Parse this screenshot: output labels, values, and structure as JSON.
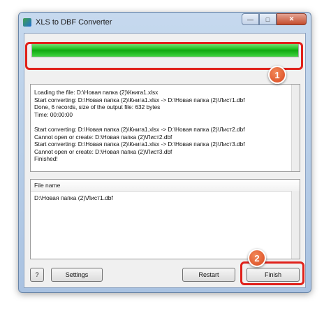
{
  "window": {
    "title": "XLS to DBF Converter",
    "controls": {
      "minimize": "—",
      "maximize": "□",
      "close": "✕"
    }
  },
  "progress": {
    "fraction": 1.0,
    "color": "#22c322"
  },
  "log": {
    "lines": [
      "Loading the file: D:\\Новая папка (2)\\Книга1.xlsx",
      "Start converting: D:\\Новая папка (2)\\Книга1.xlsx -> D:\\Новая папка (2)\\Лист1.dbf",
      "Done, 6 records, size of the output file: 632 bytes",
      "Time: 00:00:00",
      "",
      "Start converting: D:\\Новая папка (2)\\Книга1.xlsx -> D:\\Новая папка (2)\\Лист2.dbf",
      "Cannot open or create: D:\\Новая папка (2)\\Лист2.dbf",
      "Start converting: D:\\Новая папка (2)\\Книга1.xlsx -> D:\\Новая папка (2)\\Лист3.dbf",
      "Cannot open or create: D:\\Новая папка (2)\\Лист3.dbf",
      "Finished!"
    ]
  },
  "files": {
    "header": "File name",
    "rows": [
      "D:\\Новая папка (2)\\Лист1.dbf"
    ]
  },
  "buttons": {
    "help": "?",
    "settings": "Settings",
    "restart": "Restart",
    "finish": "Finish"
  },
  "annotations": [
    {
      "number": "1",
      "color": "#e0211b"
    },
    {
      "number": "2",
      "color": "#e0211b"
    }
  ]
}
